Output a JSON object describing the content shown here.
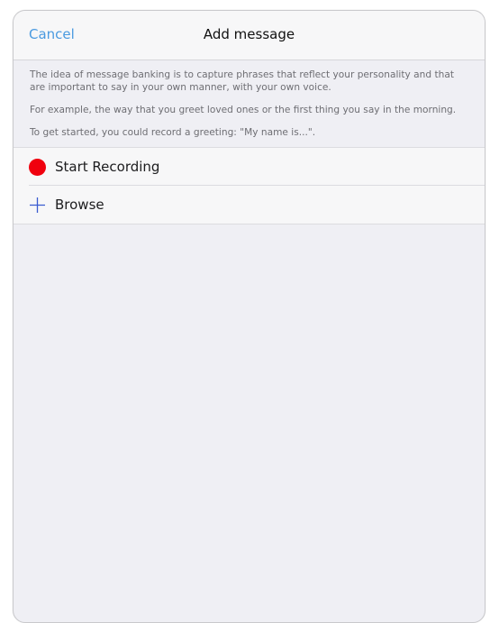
{
  "navbar": {
    "cancel_label": "Cancel",
    "title": "Add message"
  },
  "info": {
    "paragraphs": [
      "The idea of message banking is to capture phrases that reflect your personality and that are important to say in your own manner, with your own voice.",
      "For example, the way that you greet loved ones or the first thing you say in the morning.",
      "To get started, you could record a greeting: \"My name is...\"."
    ]
  },
  "actions": [
    {
      "label": "Start Recording",
      "icon": "record-icon",
      "icon_color": "#f0000e"
    },
    {
      "label": "Browse",
      "icon": "plus-icon",
      "icon_color": "#3a5bd0"
    }
  ],
  "colors": {
    "accent": "#4a9ae0",
    "background": "#efeff4"
  }
}
